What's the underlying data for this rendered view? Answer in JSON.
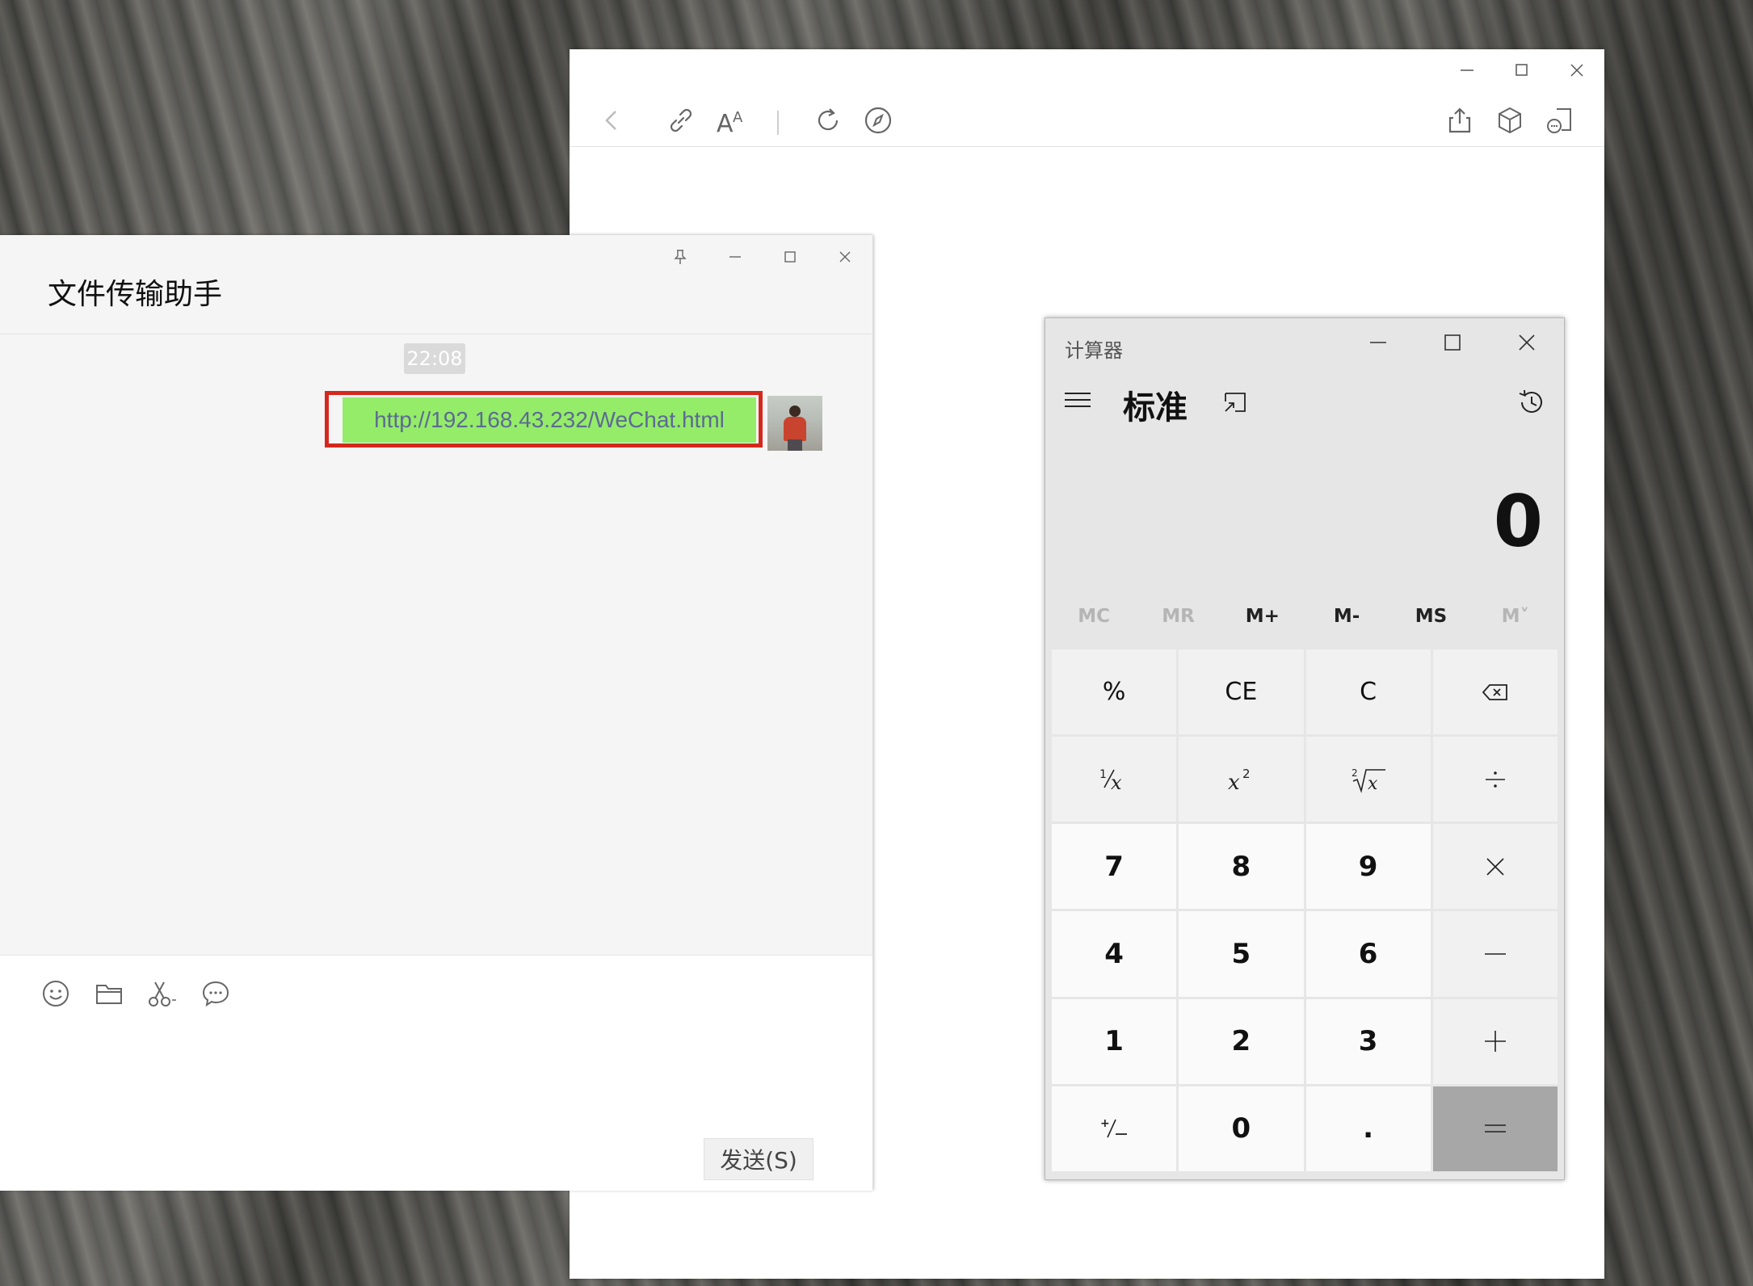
{
  "wechat": {
    "title": "文件传输助手",
    "timestamp": "22:08",
    "message": "http://192.168.43.232/WeChat.html",
    "send_label": "发送(S)"
  },
  "calculator": {
    "app_title": "计算器",
    "mode": "标准",
    "display": "0",
    "memory": [
      "MC",
      "MR",
      "M+",
      "M-",
      "MS",
      "M˅"
    ],
    "keys": {
      "percent": "%",
      "ce": "CE",
      "c": "C",
      "n7": "7",
      "n8": "8",
      "n9": "9",
      "n4": "4",
      "n5": "5",
      "n6": "6",
      "n1": "1",
      "n2": "2",
      "n3": "3",
      "n0": "0",
      "dot": "."
    }
  },
  "colors": {
    "bubble": "#95ec69",
    "highlight_border": "#d4281e",
    "link_text": "#5b6b93",
    "equals_key": "#a7a7a7"
  }
}
